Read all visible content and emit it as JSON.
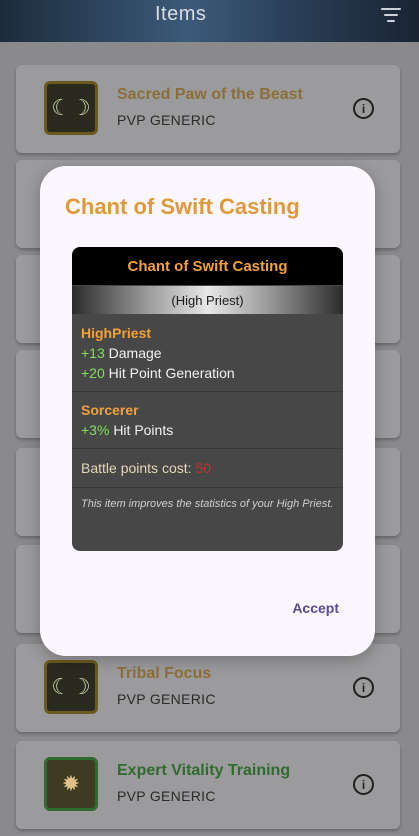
{
  "appbar": {
    "title": "Items"
  },
  "list": {
    "items": [
      {
        "name": "Sacred Paw of the Beast",
        "type": "PVP GENERIC",
        "icon": "claw-emblem-icon"
      },
      {
        "name": "Tribal Focus",
        "type": "PVP GENERIC",
        "icon": "claw-emblem-icon"
      },
      {
        "name": "Expert Vitality Training",
        "type": "PVP GENERIC",
        "icon": "shield-claw-icon"
      }
    ],
    "info_symbol": "i"
  },
  "dialog": {
    "title": "Chant of Swift Casting",
    "accept_label": "Accept",
    "tooltip": {
      "header": "Chant of Swift Casting",
      "class": "(High Priest)",
      "sections": [
        {
          "title": "HighPriest",
          "stats": [
            {
              "value": "+13",
              "label": "Damage"
            },
            {
              "value": "+20",
              "label": "Hit Point Generation"
            }
          ]
        },
        {
          "title": "Sorcerer",
          "stats": [
            {
              "value": "+3%",
              "label": "Hit Points"
            }
          ]
        }
      ],
      "cost_label": "Battle points cost:",
      "cost_value": "50",
      "description": "This item improves the statistics of your High Priest."
    }
  },
  "colors": {
    "accent_orange": "#e09a3a",
    "stat_green": "#7de05a",
    "cost_red": "#d42a2a",
    "accept_purple": "#5d4a9a"
  }
}
